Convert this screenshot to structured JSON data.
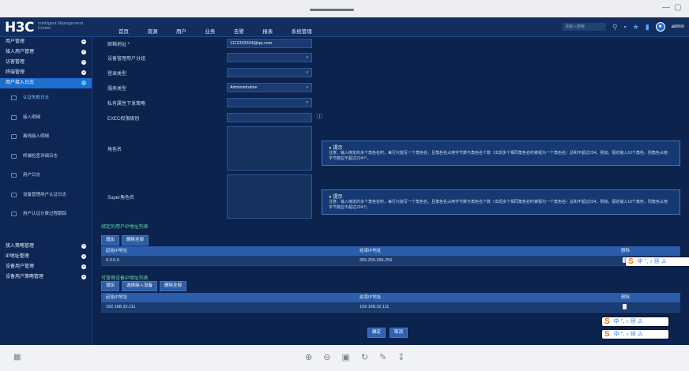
{
  "window": {
    "minimize_label": "—",
    "restore_label": "▢"
  },
  "brand": {
    "logo": "H3C",
    "subtitle": "Intelligent Management Center"
  },
  "nav": [
    "首页",
    "资源",
    "用户",
    "业务",
    "告警",
    "报表",
    "系统管理"
  ],
  "header": {
    "search_placeholder": "请输入搜索",
    "user": "admin"
  },
  "sidebar": {
    "items_top": [
      {
        "label": "用户管理"
      },
      {
        "label": "接入用户管理"
      },
      {
        "label": "访客管理"
      },
      {
        "label": "终端管理"
      },
      {
        "label": "用户接入日志",
        "active": true
      }
    ],
    "subitems": [
      {
        "label": "认证失败日志",
        "active": true
      },
      {
        "label": "接入明细"
      },
      {
        "label": "离线接入明细"
      },
      {
        "label": "终端检查详细日志"
      },
      {
        "label": "用户日志"
      },
      {
        "label": "设备管理用户认证日志"
      },
      {
        "label": "用户认证计费过程跟踪"
      }
    ],
    "items_bottom": [
      {
        "label": "接入策略管理"
      },
      {
        "label": "IP地址管理"
      },
      {
        "label": "设备用户管理"
      },
      {
        "label": "设备用户策略管理"
      }
    ]
  },
  "form": {
    "email_label": "邮箱地址 *",
    "email_value": "1112333334@qq.com",
    "group_label": "设备管理用户分组",
    "login_type_label": "登录类型",
    "service_type_label": "服务类型",
    "service_type_value": "Administrative",
    "priv_label": "私有属性下发策略",
    "exec_label": "EXEC权限级别",
    "role_label": "角色名",
    "super_role_label": "Super角色名",
    "tip_title": "提示",
    "tip_body": "注意：输入绑定的多个角色名时，每行只能写一个角色名，且角色名占用字节数与角色名个数（出现多个相同角色名时被视为一个角色名）总和不超过234。例如，假定输入10个角色，则角色占用字节数应不超过224个。"
  },
  "bind_section": {
    "title": "绑定的用户IP地址列表",
    "add_label": "增加",
    "delete_all_label": "删除全部",
    "headers": [
      "起始IP地址",
      "结束IP地址",
      "删除"
    ],
    "rows": [
      {
        "start": "0.0.0.0",
        "end": "255.255.255.255"
      }
    ]
  },
  "manage_section": {
    "title": "可管理设备IP地址列表",
    "add_label": "增加",
    "select_label": "选择接入设备",
    "delete_all_label": "删除全部",
    "headers": [
      "起始IP地址",
      "结束IP地址",
      "删除"
    ],
    "rows": [
      {
        "start": "192.168.32.111",
        "end": "192.168.32.111"
      }
    ]
  },
  "footer": {
    "ok_label": "确定",
    "cancel_label": "取消"
  },
  "ime": {
    "logo": "S",
    "text": "中 °, ♪ ▦ ⁂"
  }
}
